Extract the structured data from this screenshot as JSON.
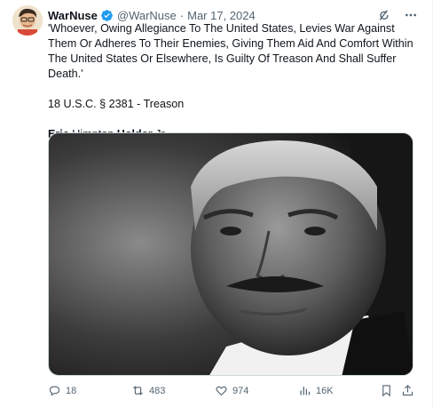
{
  "tweet": {
    "author_name": "WarNuse",
    "handle": "@WarNuse",
    "separator": "·",
    "date": "Mar 17, 2024",
    "quote": "'Whoever, Owing Allegiance To The United States, Levies War Against Them Or Adheres To Their Enemies, Giving Them Aid And Comfort Within The United States Or Elsewhere, Is Guilty Of Treason And Shall Suffer Death.'",
    "citation": "18 U.S.C. § 2381 - Treason",
    "signature": {
      "first": "Eric",
      "middle": " Himpton ",
      "last": "Holder",
      "suffix": " Jr."
    }
  },
  "actions": {
    "replies": "18",
    "reposts": "483",
    "likes": "974",
    "views": "16K"
  },
  "colors": {
    "text": "#0f1419",
    "secondary": "#536471",
    "verified": "#1d9bf0"
  }
}
